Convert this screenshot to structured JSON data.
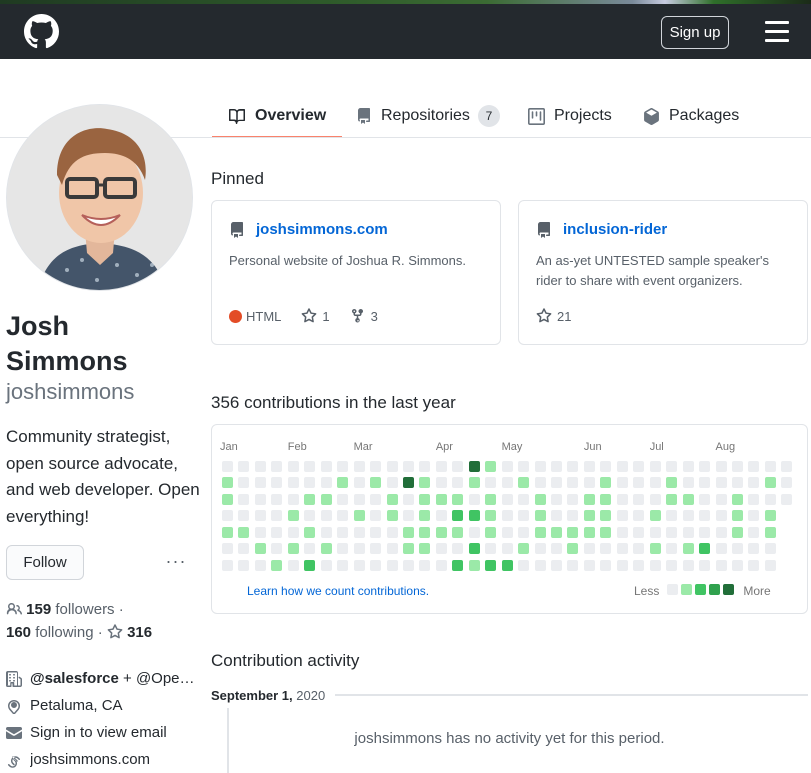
{
  "header": {
    "logo_icon": "github-mark-icon",
    "signup_label": "Sign up",
    "menu_icon": "hamburger-icon"
  },
  "tabs": [
    {
      "label": "Overview",
      "icon": "book-icon",
      "active": true
    },
    {
      "label": "Repositories",
      "icon": "repo-icon",
      "count": "7"
    },
    {
      "label": "Projects",
      "icon": "project-icon"
    },
    {
      "label": "Packages",
      "icon": "package-icon"
    }
  ],
  "profile": {
    "full_name": "Josh Simmons",
    "username": "joshsimmons",
    "bio": "Community strategist, open source advocate, and web developer. Open everything!",
    "follow_label": "Follow",
    "more_label": "···",
    "followers_count": "159",
    "followers_label": "followers",
    "following_count": "160",
    "following_label": "following",
    "stars_count": "316",
    "details": [
      {
        "icon": "organization-icon",
        "text_bold": "@salesforce",
        "text_rest": " + @Ope…"
      },
      {
        "icon": "location-icon",
        "text": "Petaluma, CA"
      },
      {
        "icon": "mail-icon",
        "text": "Sign in to view email"
      },
      {
        "icon": "link-icon",
        "text": "joshsimmons.com"
      }
    ]
  },
  "pinned": {
    "heading": "Pinned",
    "repos": [
      {
        "name": "joshsimmons.com",
        "description": "Personal website of Joshua R. Simmons.",
        "language": "HTML",
        "language_color": "#e34c26",
        "stars": "1",
        "forks": "3"
      },
      {
        "name": "inclusion-rider",
        "description": "An as-yet UNTESTED sample speaker's rider to share with event organizers.",
        "stars": "21"
      }
    ]
  },
  "contributions": {
    "heading": "356 contributions in the last year",
    "learn_link": "Learn how we count contributions.",
    "legend_less": "Less",
    "legend_more": "More",
    "colors": [
      "#ebedf0",
      "#9be9a8",
      "#40c463",
      "#30a14e",
      "#216e39"
    ],
    "months": [
      {
        "label": "Jan",
        "col": 0
      },
      {
        "label": "Feb",
        "col": 4
      },
      {
        "label": "Mar",
        "col": 8
      },
      {
        "label": "Apr",
        "col": 13
      },
      {
        "label": "May",
        "col": 17
      },
      {
        "label": "Jun",
        "col": 22
      },
      {
        "label": "Jul",
        "col": 26
      },
      {
        "label": "Aug",
        "col": 30
      }
    ],
    "num_weeks": 35,
    "last_week_days": 3,
    "active_cells": [
      [
        0,
        1,
        1
      ],
      [
        0,
        2,
        1
      ],
      [
        0,
        4,
        1
      ],
      [
        1,
        4,
        1
      ],
      [
        2,
        5,
        1
      ],
      [
        3,
        6,
        1
      ],
      [
        4,
        3,
        1
      ],
      [
        4,
        5,
        1
      ],
      [
        5,
        2,
        1
      ],
      [
        5,
        4,
        1
      ],
      [
        5,
        6,
        2
      ],
      [
        6,
        2,
        1
      ],
      [
        6,
        5,
        1
      ],
      [
        7,
        1,
        1
      ],
      [
        8,
        3,
        1
      ],
      [
        9,
        1,
        1
      ],
      [
        10,
        2,
        1
      ],
      [
        10,
        3,
        1
      ],
      [
        11,
        1,
        4
      ],
      [
        11,
        4,
        1
      ],
      [
        11,
        5,
        1
      ],
      [
        12,
        1,
        1
      ],
      [
        12,
        2,
        1
      ],
      [
        12,
        3,
        1
      ],
      [
        12,
        4,
        1
      ],
      [
        12,
        5,
        1
      ],
      [
        13,
        2,
        1
      ],
      [
        13,
        4,
        1
      ],
      [
        14,
        2,
        1
      ],
      [
        14,
        3,
        2
      ],
      [
        14,
        4,
        1
      ],
      [
        14,
        6,
        2
      ],
      [
        15,
        0,
        4
      ],
      [
        15,
        1,
        1
      ],
      [
        15,
        3,
        2
      ],
      [
        15,
        5,
        2
      ],
      [
        15,
        6,
        1
      ],
      [
        16,
        0,
        1
      ],
      [
        16,
        2,
        1
      ],
      [
        16,
        3,
        1
      ],
      [
        16,
        4,
        1
      ],
      [
        16,
        6,
        2
      ],
      [
        17,
        6,
        2
      ],
      [
        18,
        1,
        1
      ],
      [
        18,
        5,
        1
      ],
      [
        19,
        2,
        1
      ],
      [
        19,
        3,
        1
      ],
      [
        19,
        4,
        1
      ],
      [
        20,
        4,
        1
      ],
      [
        21,
        4,
        1
      ],
      [
        21,
        5,
        1
      ],
      [
        22,
        2,
        1
      ],
      [
        22,
        3,
        1
      ],
      [
        22,
        4,
        1
      ],
      [
        23,
        1,
        1
      ],
      [
        23,
        2,
        1
      ],
      [
        23,
        3,
        1
      ],
      [
        23,
        4,
        1
      ],
      [
        26,
        3,
        1
      ],
      [
        26,
        5,
        1
      ],
      [
        27,
        1,
        1
      ],
      [
        27,
        2,
        1
      ],
      [
        28,
        2,
        1
      ],
      [
        28,
        5,
        1
      ],
      [
        29,
        5,
        2
      ],
      [
        31,
        2,
        1
      ],
      [
        31,
        3,
        1
      ],
      [
        31,
        4,
        1
      ],
      [
        33,
        1,
        1
      ],
      [
        33,
        3,
        1
      ],
      [
        33,
        4,
        1
      ]
    ]
  },
  "activity": {
    "heading": "Contribution activity",
    "date_bold": "September 1,",
    "date_year": " 2020",
    "empty_message": "joshsimmons has no activity yet for this period."
  }
}
